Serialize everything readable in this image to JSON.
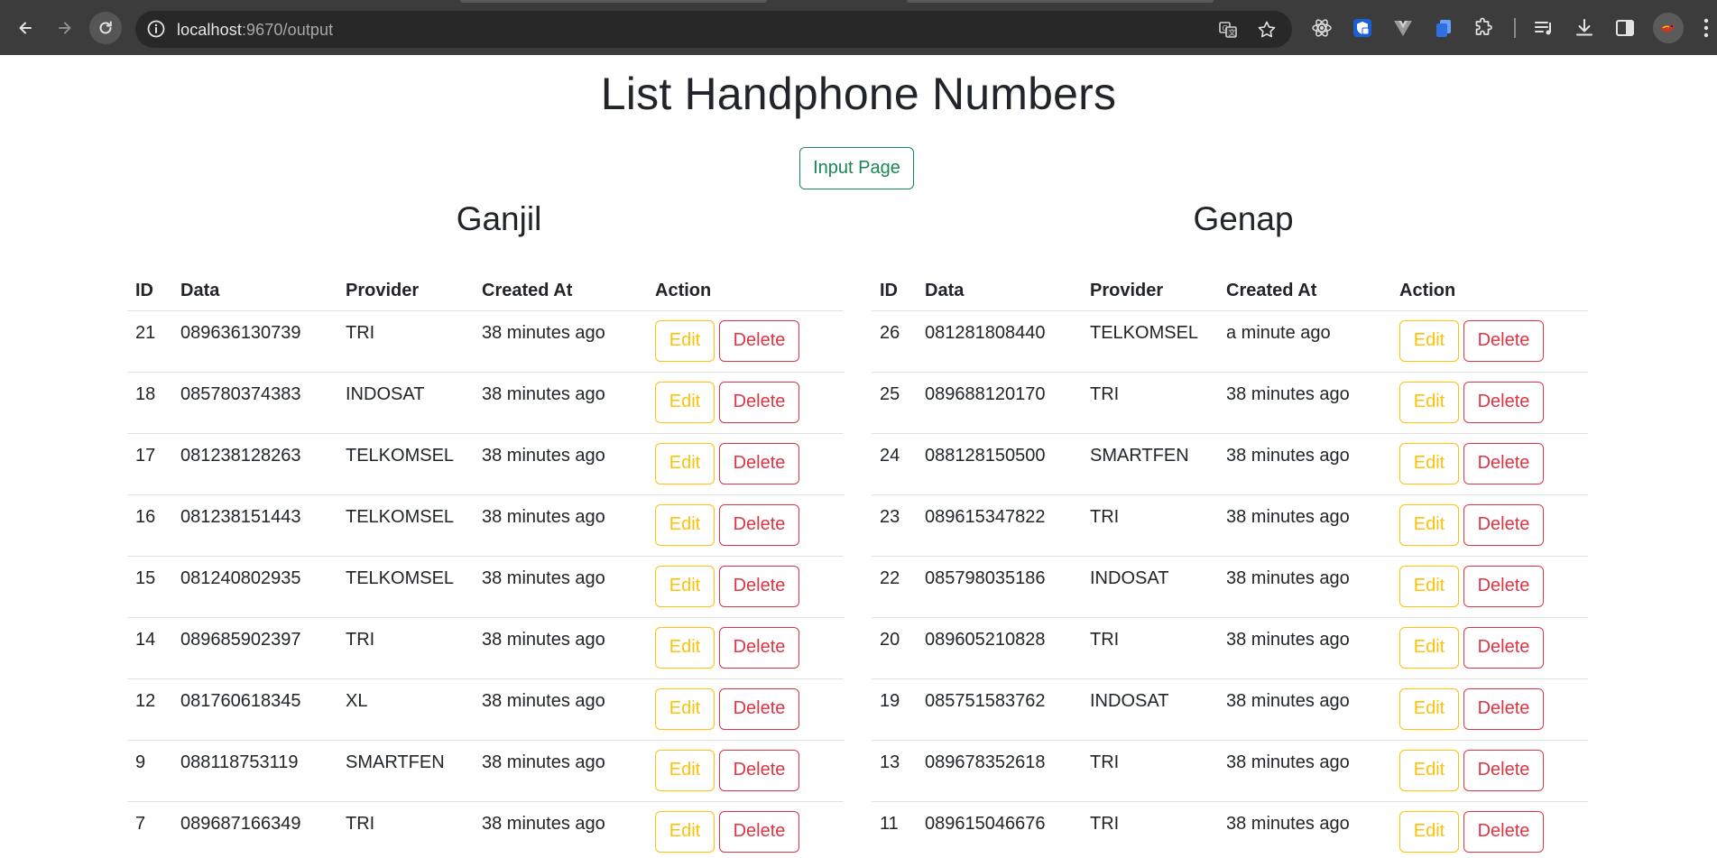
{
  "browser": {
    "url_host": "localhost",
    "url_rest": ":9670/output"
  },
  "page": {
    "title": "List Handphone Numbers",
    "input_page_label": "Input Page"
  },
  "columns": [
    "ID",
    "Data",
    "Provider",
    "Created At",
    "Action"
  ],
  "actions": {
    "edit": "Edit",
    "delete": "Delete"
  },
  "ganjil": {
    "title": "Ganjil",
    "rows": [
      {
        "id": "21",
        "data": "089636130739",
        "provider": "TRI",
        "created": "38 minutes ago"
      },
      {
        "id": "18",
        "data": "085780374383",
        "provider": "INDOSAT",
        "created": "38 minutes ago"
      },
      {
        "id": "17",
        "data": "081238128263",
        "provider": "TELKOMSEL",
        "created": "38 minutes ago"
      },
      {
        "id": "16",
        "data": "081238151443",
        "provider": "TELKOMSEL",
        "created": "38 minutes ago"
      },
      {
        "id": "15",
        "data": "081240802935",
        "provider": "TELKOMSEL",
        "created": "38 minutes ago"
      },
      {
        "id": "14",
        "data": "089685902397",
        "provider": "TRI",
        "created": "38 minutes ago"
      },
      {
        "id": "12",
        "data": "081760618345",
        "provider": "XL",
        "created": "38 minutes ago"
      },
      {
        "id": "9",
        "data": "088118753119",
        "provider": "SMARTFEN",
        "created": "38 minutes ago"
      },
      {
        "id": "7",
        "data": "089687166349",
        "provider": "TRI",
        "created": "38 minutes ago"
      }
    ]
  },
  "genap": {
    "title": "Genap",
    "rows": [
      {
        "id": "26",
        "data": "081281808440",
        "provider": "TELKOMSEL",
        "created": "a minute ago"
      },
      {
        "id": "25",
        "data": "089688120170",
        "provider": "TRI",
        "created": "38 minutes ago"
      },
      {
        "id": "24",
        "data": "088128150500",
        "provider": "SMARTFEN",
        "created": "38 minutes ago"
      },
      {
        "id": "23",
        "data": "089615347822",
        "provider": "TRI",
        "created": "38 minutes ago"
      },
      {
        "id": "22",
        "data": "085798035186",
        "provider": "INDOSAT",
        "created": "38 minutes ago"
      },
      {
        "id": "20",
        "data": "089605210828",
        "provider": "TRI",
        "created": "38 minutes ago"
      },
      {
        "id": "19",
        "data": "085751583762",
        "provider": "INDOSAT",
        "created": "38 minutes ago"
      },
      {
        "id": "13",
        "data": "089678352618",
        "provider": "TRI",
        "created": "38 minutes ago"
      },
      {
        "id": "11",
        "data": "089615046676",
        "provider": "TRI",
        "created": "38 minutes ago"
      }
    ]
  },
  "colors": {
    "success": "#198754",
    "warning": "#ffc107",
    "danger": "#dc3545",
    "chrome": "#3c3c3c"
  }
}
